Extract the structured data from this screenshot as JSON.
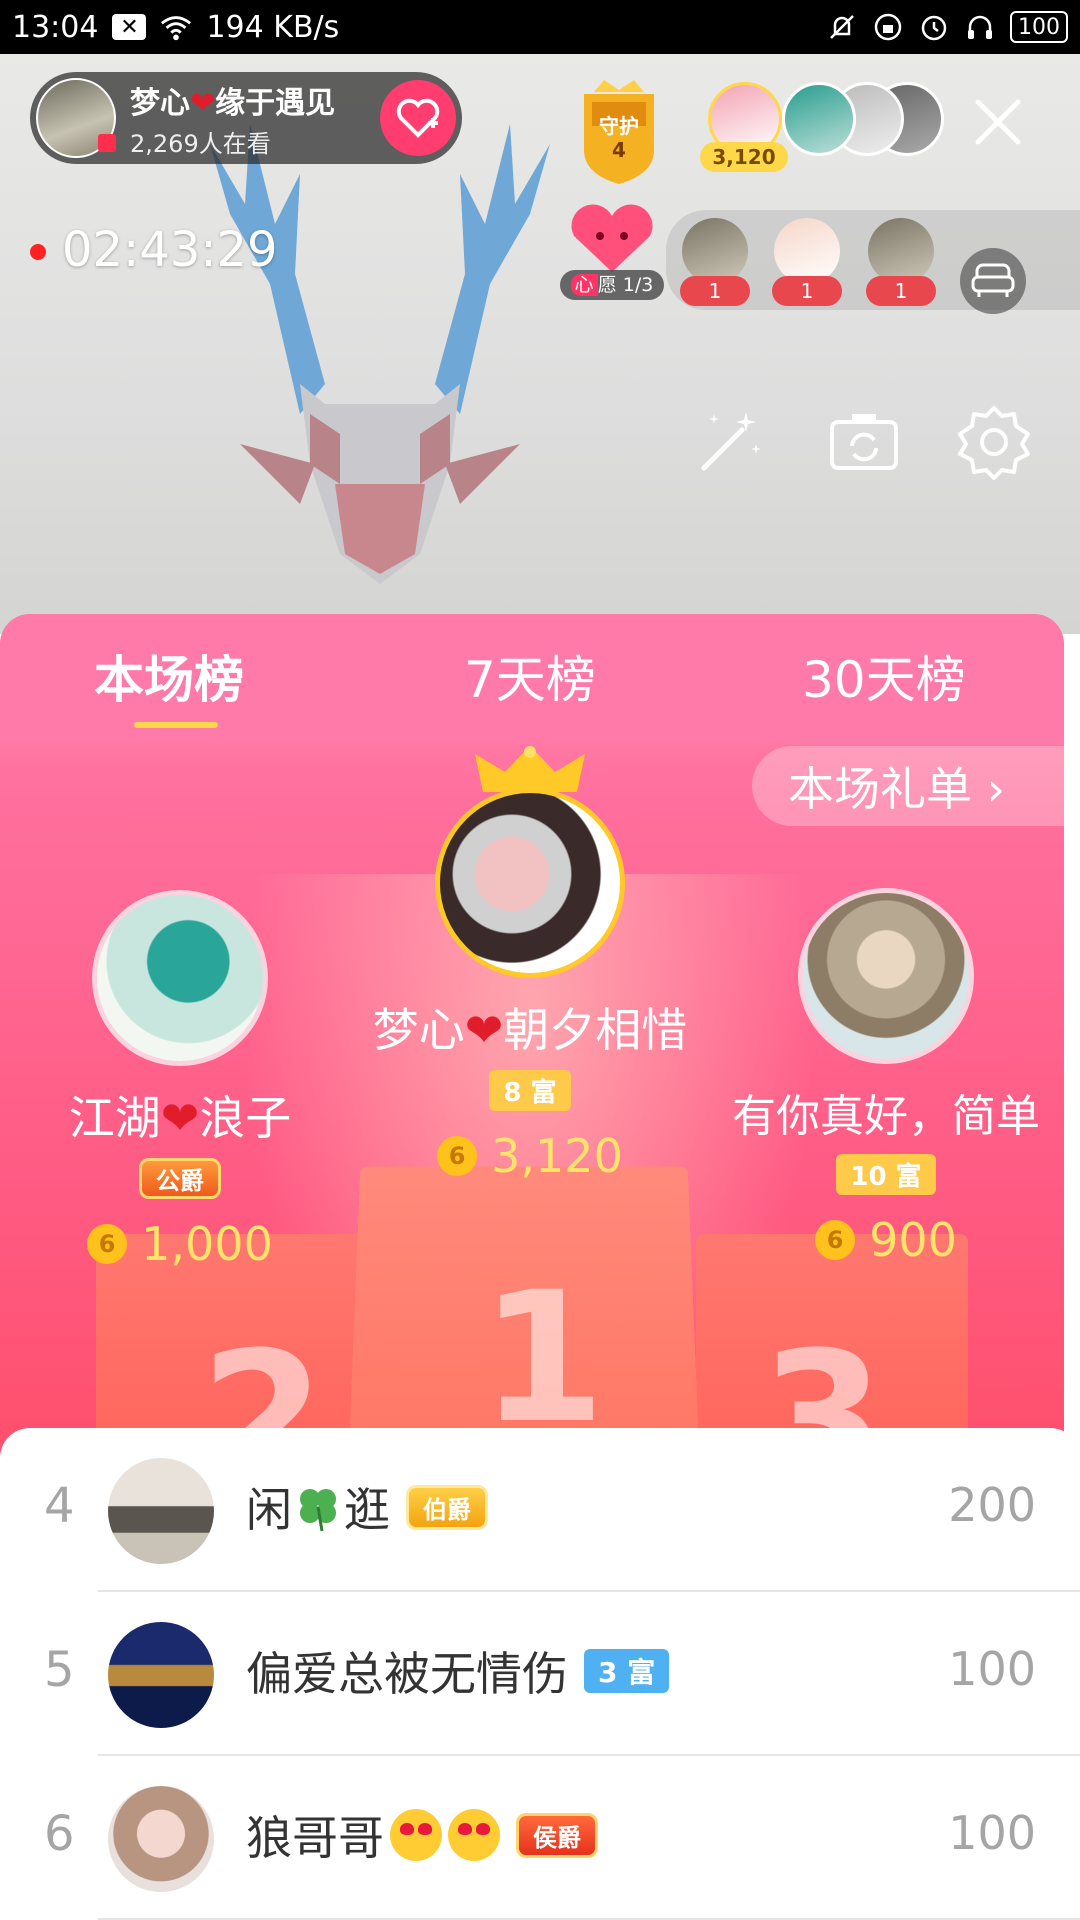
{
  "status_bar": {
    "time": "13:04",
    "net_speed": "194 KB/s",
    "battery": "100"
  },
  "live": {
    "host_name": "梦心",
    "host_name_suffix": "缘于遇见",
    "viewers": "2,269人在看",
    "guard_label": "守护",
    "guard_count": "4",
    "top_fan_coins": "3,120",
    "timer": "02:43:29",
    "wish_tag": "心",
    "wish_text": "愿 1/3",
    "guests": [
      {
        "count": "1"
      },
      {
        "count": "1"
      },
      {
        "count": "1"
      }
    ]
  },
  "tabs": [
    {
      "label": "本场榜",
      "active": true
    },
    {
      "label": "7天榜",
      "active": false
    },
    {
      "label": "30天榜",
      "active": false
    }
  ],
  "gift_list_button": "本场礼单 ›",
  "podium": {
    "first": {
      "name_a": "梦心",
      "name_b": "朝夕相惜",
      "badge": "8 富",
      "amount": "3,120"
    },
    "second": {
      "name_a": "江湖",
      "name_b": "浪子",
      "badge": "公爵",
      "amount": "1,000"
    },
    "third": {
      "name": "有你真好，简单",
      "badge": "10 富",
      "amount": "900"
    },
    "numbers": [
      "1",
      "2",
      "3"
    ]
  },
  "coin_glyph": "6",
  "list": [
    {
      "rank": "4",
      "name_a": "闲",
      "name_b": "逛",
      "badge": "伯爵",
      "value": "200"
    },
    {
      "rank": "5",
      "name": "偏爱总被无情伤",
      "badge": "3 富",
      "value": "100"
    },
    {
      "rank": "6",
      "name": "狼哥哥",
      "badge": "侯爵",
      "value": "100"
    }
  ],
  "colors": {
    "accent_pink": "#ff5a82",
    "tab_bar": "#ff7aa8",
    "gold": "#ffc94a",
    "list_text": "#333333"
  }
}
